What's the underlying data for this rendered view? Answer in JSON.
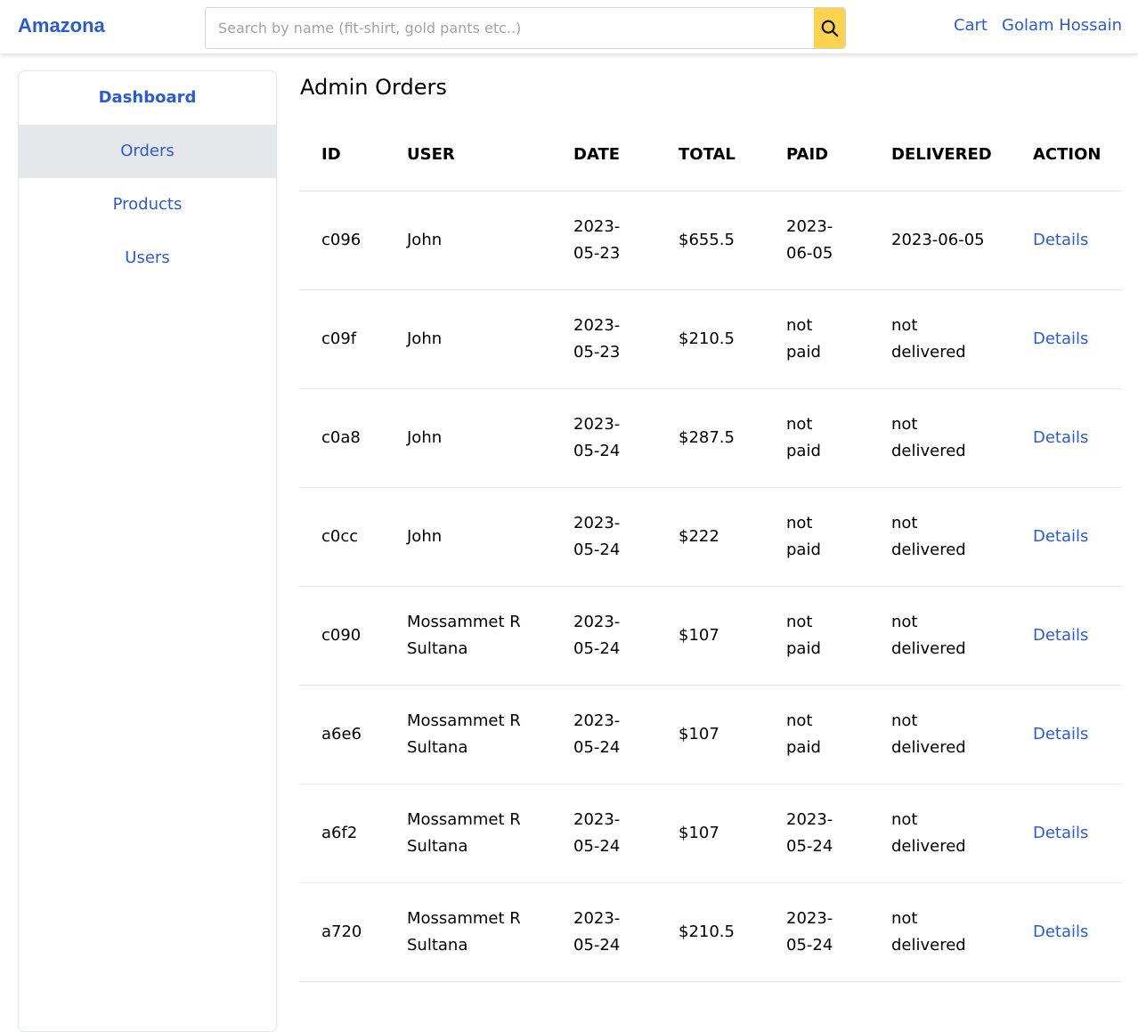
{
  "header": {
    "brand": "Amazona",
    "search_placeholder": "Search by name (fit-shirt, gold pants etc..)",
    "search_icon": "search-icon",
    "cart_label": "Cart",
    "user_name": "Golam Hossain"
  },
  "sidebar": {
    "items": [
      {
        "label": "Dashboard"
      },
      {
        "label": "Orders"
      },
      {
        "label": "Products"
      },
      {
        "label": "Users"
      }
    ]
  },
  "main": {
    "title": "Admin Orders",
    "columns": [
      "ID",
      "USER",
      "DATE",
      "TOTAL",
      "PAID",
      "DELIVERED",
      "ACTION"
    ],
    "rows": [
      {
        "id": "c096",
        "user": [
          "John"
        ],
        "date": [
          "2023-",
          "05-23"
        ],
        "total": "$655.5",
        "paid": [
          "2023-",
          "06-05"
        ],
        "delivered": [
          "2023-06-05"
        ],
        "action": "Details"
      },
      {
        "id": "c09f",
        "user": [
          "John"
        ],
        "date": [
          "2023-",
          "05-23"
        ],
        "total": "$210.5",
        "paid": [
          "not",
          "paid"
        ],
        "delivered": [
          "not",
          "delivered"
        ],
        "action": "Details"
      },
      {
        "id": "c0a8",
        "user": [
          "John"
        ],
        "date": [
          "2023-",
          "05-24"
        ],
        "total": "$287.5",
        "paid": [
          "not",
          "paid"
        ],
        "delivered": [
          "not",
          "delivered"
        ],
        "action": "Details"
      },
      {
        "id": "c0cc",
        "user": [
          "John"
        ],
        "date": [
          "2023-",
          "05-24"
        ],
        "total": "$222",
        "paid": [
          "not",
          "paid"
        ],
        "delivered": [
          "not",
          "delivered"
        ],
        "action": "Details"
      },
      {
        "id": "c090",
        "user": [
          "Mossammet R",
          "Sultana"
        ],
        "date": [
          "2023-",
          "05-24"
        ],
        "total": "$107",
        "paid": [
          "not",
          "paid"
        ],
        "delivered": [
          "not",
          "delivered"
        ],
        "action": "Details"
      },
      {
        "id": "a6e6",
        "user": [
          "Mossammet R",
          "Sultana"
        ],
        "date": [
          "2023-",
          "05-24"
        ],
        "total": "$107",
        "paid": [
          "not",
          "paid"
        ],
        "delivered": [
          "not",
          "delivered"
        ],
        "action": "Details"
      },
      {
        "id": "a6f2",
        "user": [
          "Mossammet R",
          "Sultana"
        ],
        "date": [
          "2023-",
          "05-24"
        ],
        "total": "$107",
        "paid": [
          "2023-",
          "05-24"
        ],
        "delivered": [
          "not",
          "delivered"
        ],
        "action": "Details"
      },
      {
        "id": "a720",
        "user": [
          "Mossammet R",
          "Sultana"
        ],
        "date": [
          "2023-",
          "05-24"
        ],
        "total": "$210.5",
        "paid": [
          "2023-",
          "05-24"
        ],
        "delivered": [
          "not",
          "delivered"
        ],
        "action": "Details"
      }
    ]
  },
  "colors": {
    "link": "#2a5bd7",
    "search_button": "#fcd34d",
    "active_sidebar_bg": "#e5e7eb"
  }
}
